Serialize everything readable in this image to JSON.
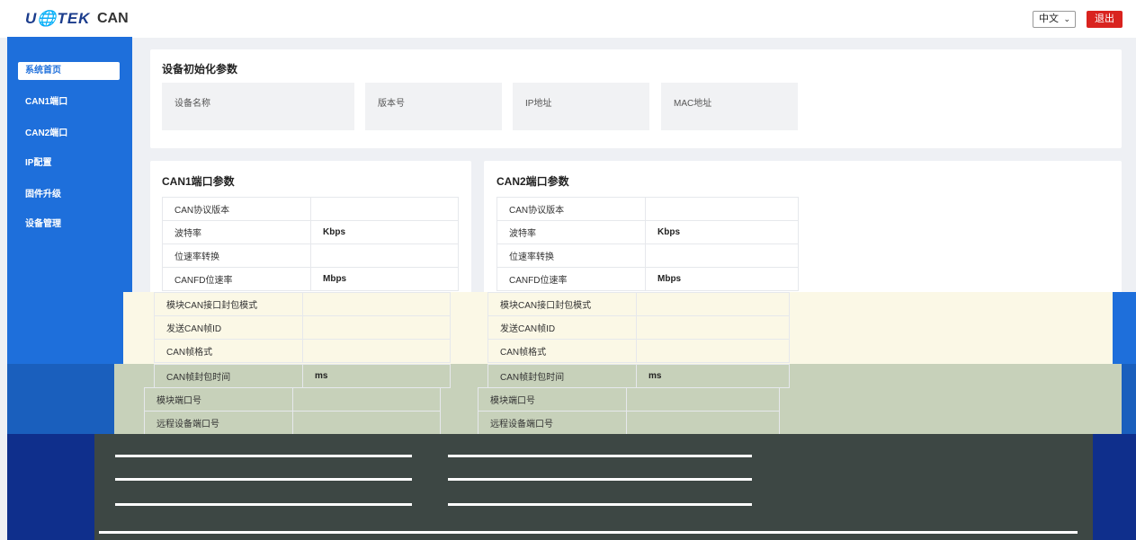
{
  "header": {
    "logo": "U🌐TEK",
    "app_name": "CAN",
    "language": "中文",
    "logout_label": "退出"
  },
  "sidebar": {
    "items": [
      {
        "label": "系统首页",
        "active": true
      },
      {
        "label": "CAN1端口"
      },
      {
        "label": "CAN2端口"
      },
      {
        "label": "IP配置"
      },
      {
        "label": "固件升级"
      },
      {
        "label": "设备管理"
      }
    ]
  },
  "device_init": {
    "title": "设备初始化参数",
    "fields": [
      "设备名称",
      "版本号",
      "IP地址",
      "MAC地址"
    ]
  },
  "can1": {
    "title": "CAN1端口参数",
    "rows": [
      {
        "label": "CAN协议版本",
        "value": ""
      },
      {
        "label": "波特率",
        "value": "Kbps"
      },
      {
        "label": "位速率转换",
        "value": ""
      },
      {
        "label": "CANFD位速率",
        "value": "Mbps"
      },
      {
        "label": "模块CAN接口封包模式",
        "value": ""
      },
      {
        "label": "发送CAN帧ID",
        "value": ""
      },
      {
        "label": "CAN帧格式",
        "value": ""
      },
      {
        "label": "CAN帧封包时间",
        "value": "ms"
      },
      {
        "label": "模块端口号",
        "value": ""
      },
      {
        "label": "远程设备端口号",
        "value": ""
      }
    ]
  },
  "can2": {
    "title": "CAN2端口参数",
    "rows": [
      {
        "label": "CAN协议版本",
        "value": ""
      },
      {
        "label": "波特率",
        "value": "Kbps"
      },
      {
        "label": "位速率转换",
        "value": ""
      },
      {
        "label": "CANFD位速率",
        "value": "Mbps"
      },
      {
        "label": "模块CAN接口封包模式",
        "value": ""
      },
      {
        "label": "发送CAN帧ID",
        "value": ""
      },
      {
        "label": "CAN帧格式",
        "value": ""
      },
      {
        "label": "CAN帧封包时间",
        "value": "ms"
      },
      {
        "label": "模块端口号",
        "value": ""
      },
      {
        "label": "远程设备端口号",
        "value": ""
      }
    ]
  },
  "colors": {
    "accent": "#1e6fdb",
    "danger": "#d9231f",
    "artifact_cream": "#fbf8e6",
    "artifact_olive": "#c7d1ba",
    "artifact_dark": "#3d4744"
  }
}
